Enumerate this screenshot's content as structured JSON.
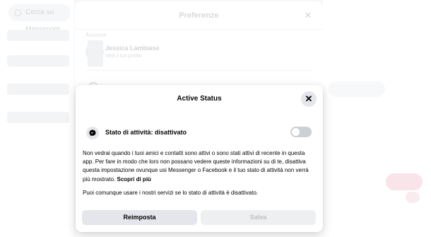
{
  "background": {
    "search_placeholder": "Cerca su Messenger"
  },
  "preferences": {
    "title": "Preferenze",
    "close_glyph": "✕",
    "section_label": "Account",
    "account_name": "Jessica Lambiase",
    "account_sub": "Vedi il tuo profilo"
  },
  "active_status": {
    "title": "Active Status",
    "close_glyph": "✕",
    "icon": "messenger-icon",
    "status_label": "Stato di attività: disattivato",
    "toggle_on": false,
    "description": "Non vedrai quando i tuoi amici e contatti sono attivi o sono stati attivi di recente in questa app. Per fare in modo che loro non possano vedere queste informazioni su di te, disattiva questa impostazione ovunque usi Messenger o Facebook e il tuo stato di attività non verrà più mostrato.",
    "learn_more": "Scopri di più",
    "note": "Puoi comunque usare i nostri servizi se lo stato di attività è disattivato.",
    "reset_label": "Reimposta",
    "save_label": "Salva"
  },
  "colors": {
    "button_gray": "#e4e6eb",
    "disabled_text": "#bcc0c4",
    "toggle_off": "#ccd0d5"
  }
}
